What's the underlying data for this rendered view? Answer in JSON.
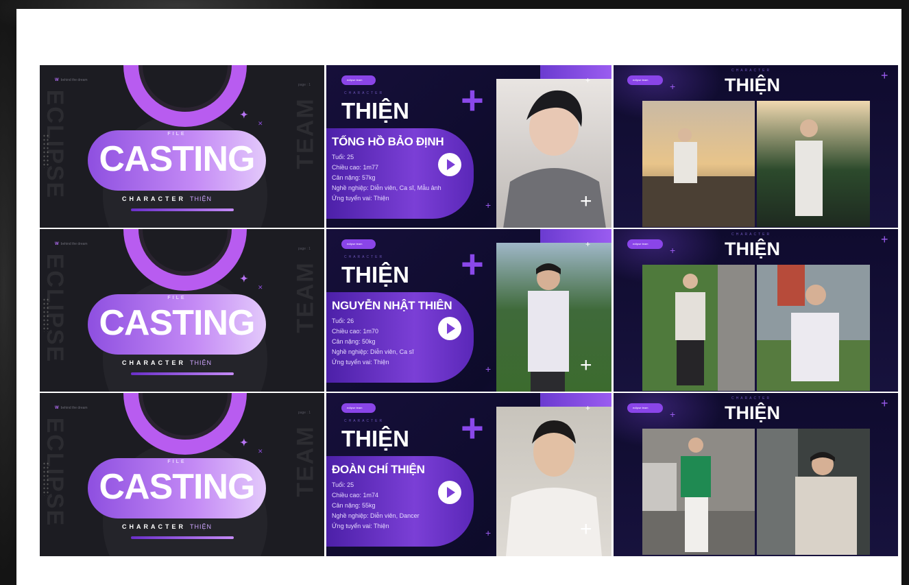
{
  "cover": {
    "brand_mark": "W",
    "brand_text": "behind the dream",
    "page_label": "page : 1",
    "file_label": "FILE",
    "title": "CASTING",
    "character_label": "CHARACTER",
    "character_name": "THIỆN",
    "vertical_left": "ECLIPSE",
    "vertical_right": "TEAM"
  },
  "profile_common": {
    "chip": "eclipse team",
    "character_label": "CHARACTER",
    "role_name": "THIỆN"
  },
  "gallery_common": {
    "chip": "eclipse team",
    "character_label": "CHARACTER",
    "role_name": "THIỆN"
  },
  "rows": [
    {
      "full_name": "TỐNG HỒ BẢO ĐỊNH",
      "info": [
        "Tuổi: 25",
        "Chiều cao: 1m77",
        "Cân nặng: 57kg",
        "Nghề nghiệp: Diễn viên, Ca sĩ, Mẫu ảnh",
        "Ứng tuyển vai: Thiện"
      ]
    },
    {
      "full_name": "NGUYỄN NHẬT THIÊN",
      "info": [
        "Tuổi: 26",
        "Chiều cao: 1m70",
        "Cân nặng: 50kg",
        "Nghề nghiệp: Diễn viên, Ca sĩ",
        "Ứng tuyển vai: Thiện"
      ]
    },
    {
      "full_name": "ĐOÀN CHÍ THIỆN",
      "info": [
        "Tuổi: 25",
        "Chiều cao: 1m74",
        "Cân nặng: 55kg",
        "Nghề nghiệp: Diễn viên, Dancer",
        "Ứng tuyển vai: Thiện"
      ]
    }
  ],
  "colors": {
    "accent_purple": "#8a45e8",
    "deep_navy": "#0f0b2e",
    "cover_dark": "#1c1c22"
  }
}
